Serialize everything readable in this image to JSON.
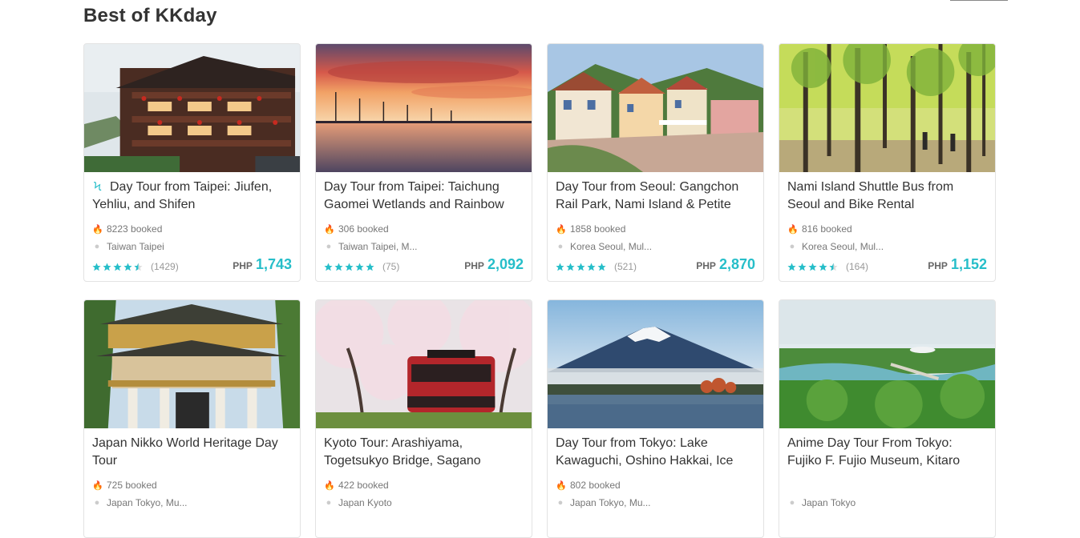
{
  "section": {
    "title": "Best of KKday"
  },
  "colors": {
    "accent": "#26bec9",
    "star": "#26bec9"
  },
  "cards": [
    {
      "title": "Day Tour from Taipei: Jiufen, Yehliu, and Shifen",
      "instant": true,
      "booked": "8223 booked",
      "location": "Taiwan Taipei",
      "rating": 4.5,
      "reviews": "(1429)",
      "currency": "PHP",
      "price": "1,743",
      "photo": "jiufen-teahouse"
    },
    {
      "title": "Day Tour from Taipei: Taichung Gaomei Wetlands and Rainbow",
      "instant": false,
      "booked": "306 booked",
      "location": "Taiwan Taipei, M...",
      "rating": 5,
      "reviews": "(75)",
      "currency": "PHP",
      "price": "2,092",
      "photo": "wetlands-sunset"
    },
    {
      "title": "Day Tour from Seoul: Gangchon Rail Park, Nami Island & Petite",
      "instant": false,
      "booked": "1858 booked",
      "location": "Korea Seoul, Mul...",
      "rating": 5,
      "reviews": "(521)",
      "currency": "PHP",
      "price": "2,870",
      "photo": "petite-france-village"
    },
    {
      "title": "Nami Island Shuttle Bus from Seoul and Bike Rental",
      "instant": false,
      "booked": "816 booked",
      "location": "Korea Seoul, Mul...",
      "rating": 4.5,
      "reviews": "(164)",
      "currency": "PHP",
      "price": "1,152",
      "photo": "nami-forest"
    },
    {
      "title": "Japan Nikko World Heritage Day Tour",
      "instant": false,
      "booked": "725 booked",
      "location": "Japan Tokyo, Mu...",
      "photo": "nikko-shrine-gate"
    },
    {
      "title": "Kyoto Tour: Arashiyama, Togetsukyo Bridge, Sagano",
      "instant": false,
      "booked": "422 booked",
      "location": "Japan Kyoto",
      "photo": "sagano-train"
    },
    {
      "title": "Day Tour from Tokyo: Lake Kawaguchi, Oshino Hakkai, Ice",
      "instant": false,
      "booked": "802 booked",
      "location": "Japan Tokyo, Mu...",
      "photo": "mount-fuji-lake"
    },
    {
      "title": "Anime Day Tour From Tokyo: Fujiko F. Fujio Museum, Kitaro",
      "instant": false,
      "booked": "",
      "location": "Japan Tokyo",
      "photo": "aerial-park"
    }
  ]
}
